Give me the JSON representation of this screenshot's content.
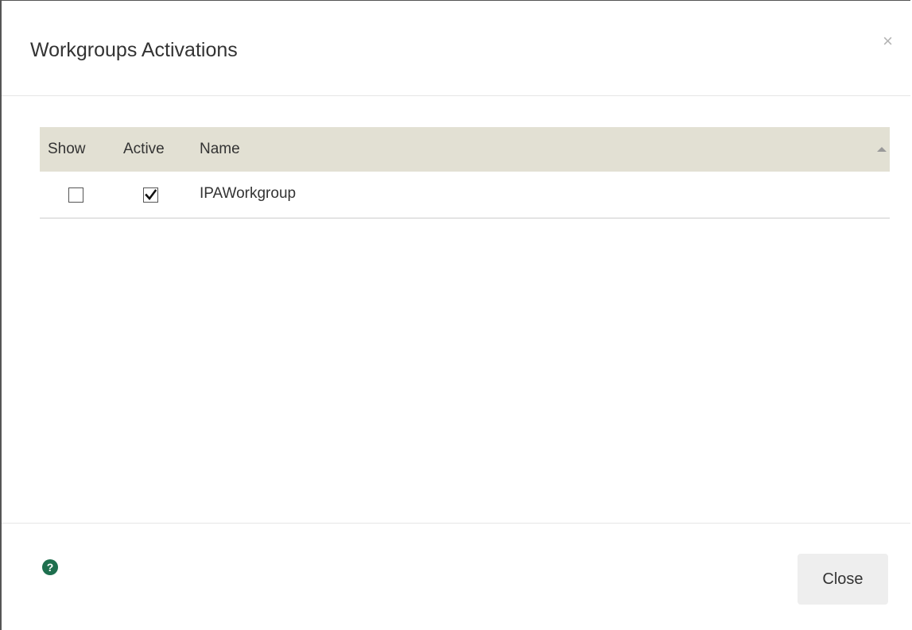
{
  "dialog": {
    "title": "Workgroups Activations",
    "close_symbol": "×"
  },
  "table": {
    "columns": [
      "Show",
      "Active",
      "Name"
    ],
    "sort": {
      "column": "Name",
      "direction": "ascending"
    },
    "rows": [
      {
        "show": false,
        "active": true,
        "name": "IPAWorkgroup"
      }
    ]
  },
  "footer": {
    "help_icon": "question-circle-icon",
    "help_symbol": "?",
    "close_label": "Close"
  },
  "colors": {
    "header_bg": "#e2e0d3",
    "help_icon": "#1e6f4e",
    "button_bg": "#eeeeee"
  }
}
